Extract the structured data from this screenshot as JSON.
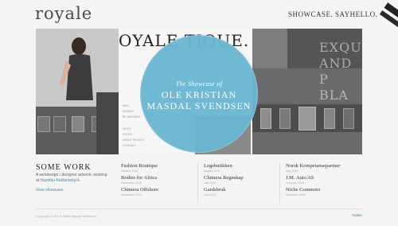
{
  "header": {
    "logo": "royale",
    "nav_label": "SHOWCASE. SAYHELLO."
  },
  "hero": {
    "logo_text": "OYALE TIQUE.",
    "overlay_lines": [
      "EXQU",
      "AND P",
      "BLA"
    ],
    "subtitle": "The Showcase of",
    "name_line1": "OLE KRISTIAN",
    "name_line2": "MASDAL SVENDSEN",
    "menu": [
      "MEN",
      "WOMEN",
      "BE INSPIRED",
      "VIDEO",
      "SHOPS",
      "ABOUT ROYALE",
      "CONTACT"
    ],
    "colors": {
      "circle": "#6ab6d0"
    }
  },
  "work": {
    "title": "SOME WORK",
    "desc_text": "A webdesign / designer artwork, working at",
    "desc_link": "Hazeblu Reklamebyrå.",
    "view_link": "View showcase"
  },
  "projects": {
    "col1": [
      {
        "title": "Fashion Boutique",
        "date": "October 2010"
      },
      {
        "title": "Bodies for Africa",
        "date": "September 2010"
      },
      {
        "title": "Chimera Offshore",
        "date": "September 2010"
      }
    ],
    "col2": [
      {
        "title": "Legebutikken",
        "date": "August 2010"
      },
      {
        "title": "Chimera Regnskap",
        "date": "July 2010"
      },
      {
        "title": "Gardsbruk",
        "date": "June 2010"
      }
    ],
    "col3": [
      {
        "title": "Norsk Kompetansepartner",
        "date": "May 2010"
      },
      {
        "title": "J.M. Auto AS",
        "date": "February 2010"
      },
      {
        "title": "Niche Commoto",
        "date": "December 2009"
      }
    ]
  },
  "footer": {
    "copyright": "Copyright © Ole Kristian Masdal Svendsen",
    "twitter": "Twitter"
  }
}
